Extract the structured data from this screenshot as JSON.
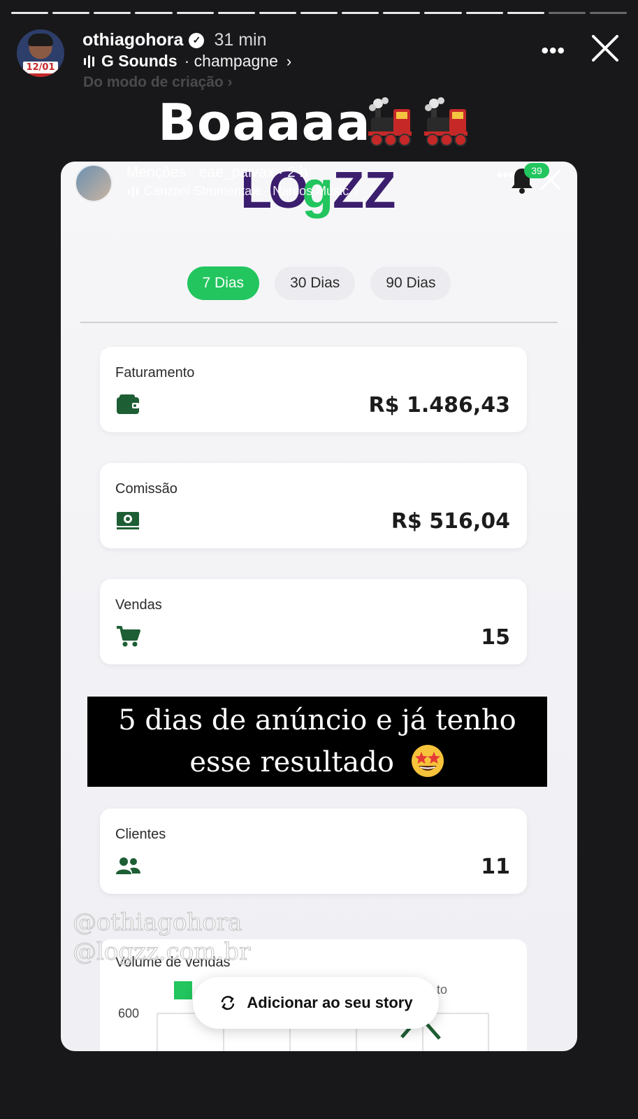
{
  "story": {
    "segments_total": 15,
    "segments_done": 13,
    "username": "othiagohora",
    "time": "31 min",
    "avatar_badge": "12/01",
    "music_artist": "G Sounds",
    "music_track": "· champagne",
    "creation_mode": "Do modo de criação",
    "caption": "Boaaaa",
    "caption_emoji": "steam-locomotive",
    "add_to_story": "Adicionar ao seu story"
  },
  "shared_story": {
    "user_line": "Menções · eae_paivax · 2 h",
    "music_line": "Canzoni Strumentale · Narcos Music",
    "notification_count": "39"
  },
  "app": {
    "logo_text": "LOGZZ",
    "brand_color": "#22c55e",
    "logo_color": "#3b1e6e",
    "ranges": [
      "7 Dias",
      "30 Dias",
      "90 Dias"
    ],
    "active_range": 0,
    "metrics": {
      "revenue": {
        "label": "Faturamento",
        "value": "R$ 1.486,43",
        "icon": "wallet-icon"
      },
      "commission": {
        "label": "Comissão",
        "value": "R$ 516,04",
        "icon": "money-icon"
      },
      "sales": {
        "label": "Vendas",
        "value": "15",
        "icon": "cart-icon"
      },
      "clients": {
        "label": "Clientes",
        "value": "11",
        "icon": "users-icon"
      }
    },
    "chart": {
      "title": "Volume de vendas",
      "y_top_tick": "600",
      "legend_partial": "to"
    }
  },
  "overlay_text": {
    "line1": "5 dias de anúncio e já tenho",
    "line2": "esse resultado",
    "emoji": "star-struck"
  },
  "watermarks": [
    "@othiagohora",
    "@logzz.com.br"
  ]
}
